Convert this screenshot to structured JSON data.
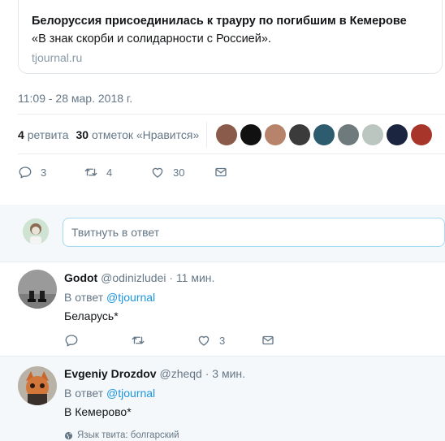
{
  "link_card": {
    "title": "Белоруссия присоединилась к трауру по погибшим в Кемерове",
    "description": "«В знак скорби и солидарности с Россией».",
    "domain": "tjournal.ru"
  },
  "timestamp": "11:09 - 28 мар. 2018 г.",
  "stats": {
    "retweets_count": "4",
    "retweets_label": "ретвита",
    "likes_count": "30",
    "likes_label": "отметок «Нравится»"
  },
  "liker_avatars": [
    {
      "name": "avatar-1",
      "color": "#8a5a4a"
    },
    {
      "name": "avatar-2",
      "color": "#111111"
    },
    {
      "name": "avatar-3",
      "color": "#b7836a"
    },
    {
      "name": "avatar-4",
      "color": "#3b3b3b"
    },
    {
      "name": "avatar-5",
      "color": "#2c5c6e"
    },
    {
      "name": "avatar-6",
      "color": "#6f7a7d"
    },
    {
      "name": "avatar-7",
      "color": "#bcc6c0"
    },
    {
      "name": "avatar-8",
      "color": "#1c2540"
    },
    {
      "name": "avatar-9",
      "color": "#a8352a"
    }
  ],
  "actions": {
    "reply_count": "3",
    "retweet_count": "4",
    "like_count": "30"
  },
  "reply_box": {
    "placeholder": "Твитнуть в ответ"
  },
  "replies": [
    {
      "name": "Godot",
      "handle": "@odinizludei",
      "dot": "·",
      "time": "11 мин.",
      "reply_to_prefix": "В ответ",
      "reply_to": "@tjournal",
      "text": "Беларусь*",
      "reply_count": "",
      "retweet_count": "",
      "like_count": "3"
    },
    {
      "name": "Evgeniy Drozdov",
      "handle": "@zheqd",
      "dot": "·",
      "time": "3 мин.",
      "reply_to_prefix": "В ответ",
      "reply_to": "@tjournal",
      "text": "В Кемерово*",
      "lang_label": "Язык твита: болгарский"
    }
  ],
  "colors": {
    "accent": "#1b95e0",
    "secondary_text": "#657786",
    "separator": "#e6ecf0"
  }
}
